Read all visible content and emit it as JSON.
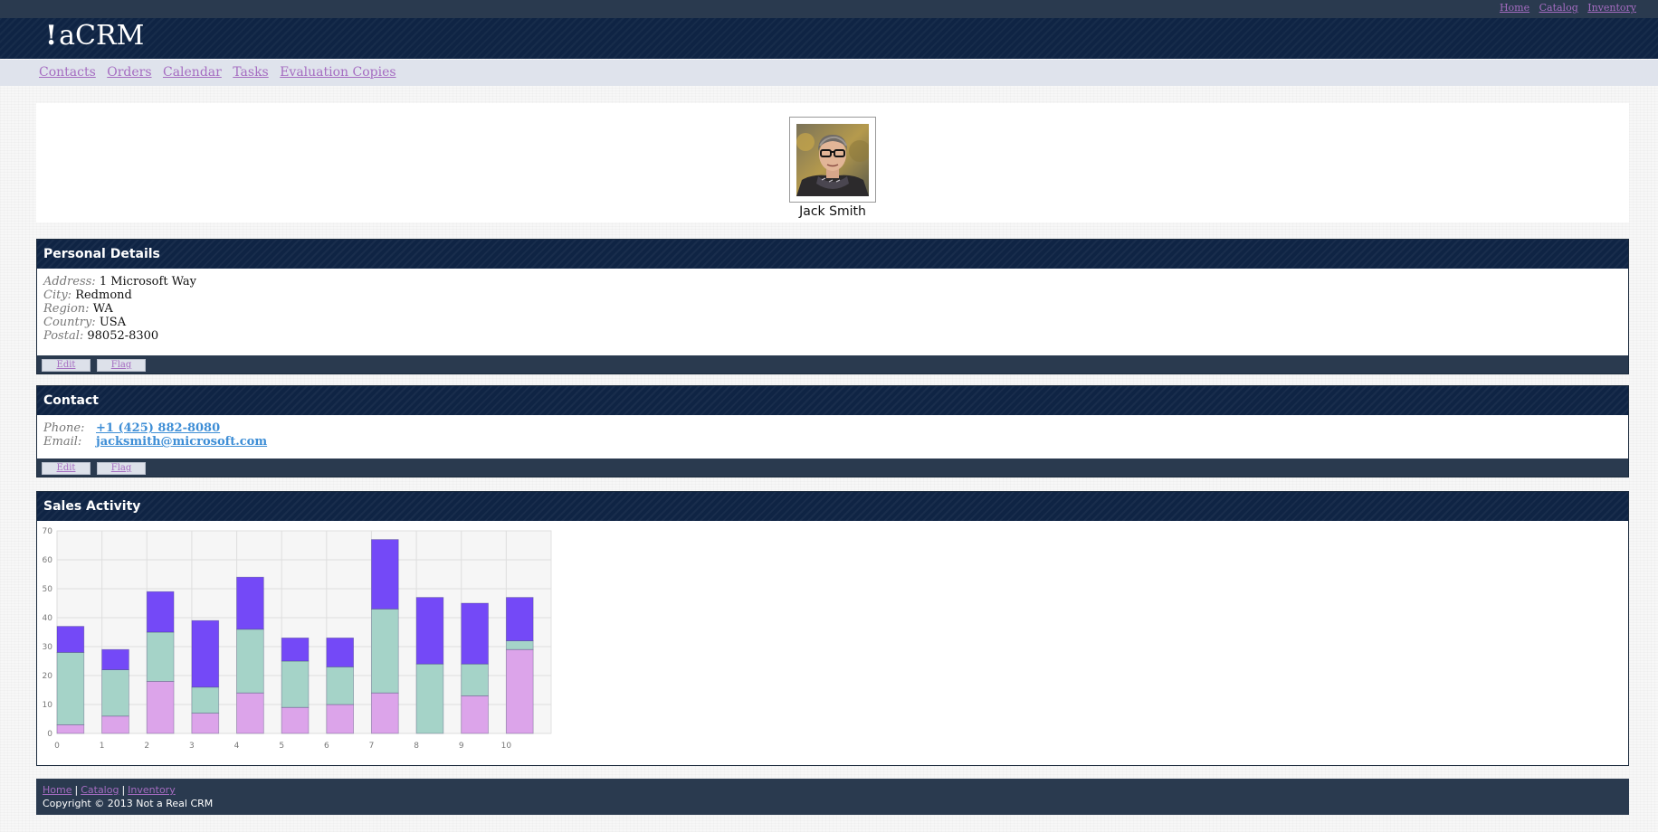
{
  "topnav": {
    "links": [
      "Home",
      "Catalog",
      "Inventory"
    ]
  },
  "brand": {
    "logo_bang": "!",
    "logo_text": "aCRM"
  },
  "mainnav": {
    "links": [
      "Contacts",
      "Orders",
      "Calendar",
      "Tasks",
      "Evaluation Copies"
    ]
  },
  "profile": {
    "name": "Jack Smith"
  },
  "personal": {
    "title": "Personal Details",
    "fields": [
      {
        "label": "Address:",
        "value": "1 Microsoft Way"
      },
      {
        "label": "City:",
        "value": "Redmond"
      },
      {
        "label": "Region:",
        "value": "WA"
      },
      {
        "label": "Country:",
        "value": "USA"
      },
      {
        "label": "Postal:",
        "value": "98052-8300"
      }
    ],
    "edit_label": "Edit",
    "flag_label": "Flag"
  },
  "contact": {
    "title": "Contact",
    "phone_label": "Phone:",
    "phone": "+1 (425) 882-8080",
    "email_label": "Email:",
    "email": "jacksmith@microsoft.com",
    "edit_label": "Edit",
    "flag_label": "Flag"
  },
  "sales": {
    "title": "Sales Activity"
  },
  "chart_data": {
    "type": "bar",
    "stacked": true,
    "categories": [
      "0",
      "1",
      "2",
      "3",
      "4",
      "5",
      "6",
      "7",
      "8",
      "9",
      "10"
    ],
    "series": [
      {
        "color": "#dca4ea",
        "values": [
          3,
          6,
          18,
          7,
          14,
          9,
          10,
          14,
          0,
          13,
          29
        ]
      },
      {
        "color": "#a5d3c8",
        "values": [
          25,
          16,
          17,
          9,
          22,
          16,
          13,
          29,
          24,
          11,
          3
        ]
      },
      {
        "color": "#7449f7",
        "values": [
          9,
          7,
          14,
          23,
          18,
          8,
          10,
          24,
          23,
          21,
          15
        ]
      }
    ],
    "yticks": [
      0,
      10,
      20,
      30,
      40,
      50,
      60,
      70
    ],
    "ylim": [
      0,
      70
    ],
    "grid": true
  },
  "footer": {
    "links": [
      "Home",
      "Catalog",
      "Inventory"
    ],
    "copyright": "Copyright © 2013 Not a Real CRM"
  }
}
